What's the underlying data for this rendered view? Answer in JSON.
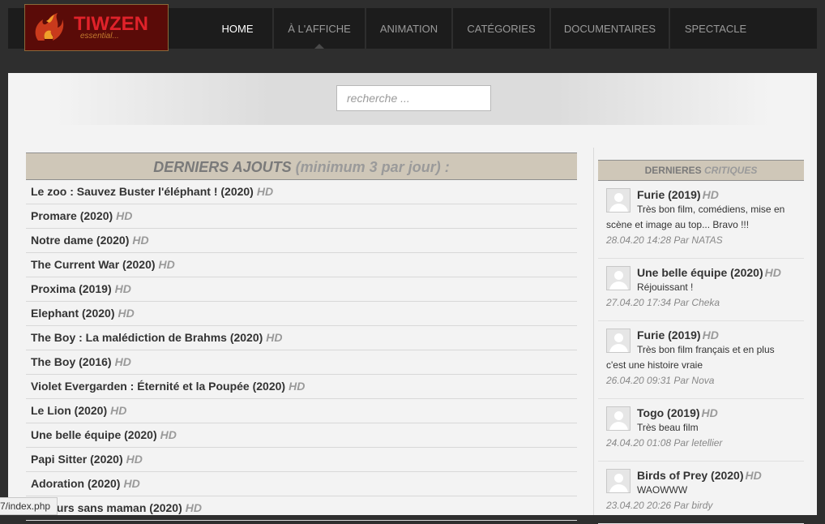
{
  "brand": {
    "title": "TIWZEN",
    "subtitle": "essential..."
  },
  "nav": [
    {
      "label": "HOME",
      "active": true
    },
    {
      "label": "À L'AFFICHE"
    },
    {
      "label": "ANIMATION"
    },
    {
      "label": "CATÉGORIES"
    },
    {
      "label": "DOCUMENTAIRES"
    },
    {
      "label": "SPECTACLE"
    }
  ],
  "search": {
    "placeholder": "recherche ..."
  },
  "latest": {
    "heading": "DERNIERS AJOUTS",
    "heading_sub": "(minimum 3 par jour) :",
    "items": [
      {
        "title": "Le zoo : Sauvez Buster l'éléphant ! (2020)",
        "badge": "HD"
      },
      {
        "title": "Promare (2020)",
        "badge": "HD"
      },
      {
        "title": "Notre dame (2020)",
        "badge": "HD"
      },
      {
        "title": "The Current War (2020)",
        "badge": "HD"
      },
      {
        "title": "Proxima (2019)",
        "badge": "HD"
      },
      {
        "title": "Elephant (2020)",
        "badge": "HD"
      },
      {
        "title": "The Boy : La malédiction de Brahms (2020)",
        "badge": "HD"
      },
      {
        "title": "The Boy (2016)",
        "badge": "HD"
      },
      {
        "title": "Violet Evergarden : Éternité et la Poupée (2020)",
        "badge": "HD"
      },
      {
        "title": "Le Lion (2020)",
        "badge": "HD"
      },
      {
        "title": "Une belle équipe (2020)",
        "badge": "HD"
      },
      {
        "title": "Papi Sitter (2020)",
        "badge": "HD"
      },
      {
        "title": "Adoration (2020)",
        "badge": "HD"
      },
      {
        "title": "40 jours sans maman (2020)",
        "badge": "HD"
      }
    ]
  },
  "reviews": {
    "heading": "DERNIERES",
    "heading_sub": "CRITIQUES",
    "items": [
      {
        "title": "Furie (2019)",
        "badge": "HD",
        "text": "Très bon film, comédiens, mise en scène et image au top... Bravo !!!",
        "meta": "28.04.20 14:28 Par NATAS"
      },
      {
        "title": "Une belle équipe (2020)",
        "badge": "HD",
        "text": "Réjouissant !",
        "meta": "27.04.20 17:34 Par Cheka"
      },
      {
        "title": "Furie (2019)",
        "badge": "HD",
        "text": "Très bon film français et en plus c'est une histoire vraie",
        "meta": "26.04.20 09:31 Par Nova"
      },
      {
        "title": "Togo (2019)",
        "badge": "HD",
        "text": "Très beau film",
        "meta": "24.04.20 01:08 Par letellier"
      },
      {
        "title": "Birds of Prey (2020)",
        "badge": "HD",
        "text": "WAOWWW",
        "meta": "23.04.20 20:26 Par birdy"
      }
    ]
  },
  "statusbar": {
    "text": "7/index.php"
  }
}
